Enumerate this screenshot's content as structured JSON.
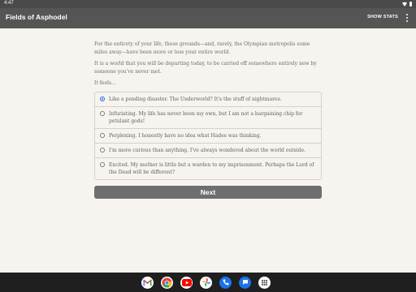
{
  "status_bar": {
    "time": "4:47"
  },
  "app_bar": {
    "title": "Fields of Asphodel",
    "show_stats_label": "SHOW STATS"
  },
  "content": {
    "paragraphs": [
      "For the entirety of your life, these grounds—and, rarely, the Olympian metropolis some miles away—have been more or less your entire world.",
      "It is a world that you will be departing today, to be carried off somewhere entirely new by someone you've never met."
    ],
    "prompt": "It feels...",
    "options": [
      {
        "text": "Like a pending disaster. The Underworld? It's the stuff of nightmares.",
        "selected": true
      },
      {
        "text": "Infuriating. My life has never been my own, but I am not a bargaining chip for petulant gods!",
        "selected": false
      },
      {
        "text": "Perplexing. I honestly have no idea what Hades was thinking.",
        "selected": false
      },
      {
        "text": "I'm more curious than anything. I've always wondered about the world outside.",
        "selected": false
      },
      {
        "text": "Excited. My mother is little but a warden to my imprisonment. Perhaps the Lord of the Dead will be different?",
        "selected": false
      }
    ],
    "next_label": "Next"
  },
  "dock": {
    "icons": [
      "gmail-icon",
      "chrome-icon",
      "youtube-icon",
      "photos-icon",
      "phone-icon",
      "messages-icon",
      "apps-icon"
    ]
  },
  "colors": {
    "app_bar": "#555555",
    "status_bar": "#4a4a4a",
    "background": "#f7f4ef",
    "button": "#6e6e6e",
    "radio_selected": "#2b62d4",
    "nav_bar": "#1f1f1f"
  }
}
